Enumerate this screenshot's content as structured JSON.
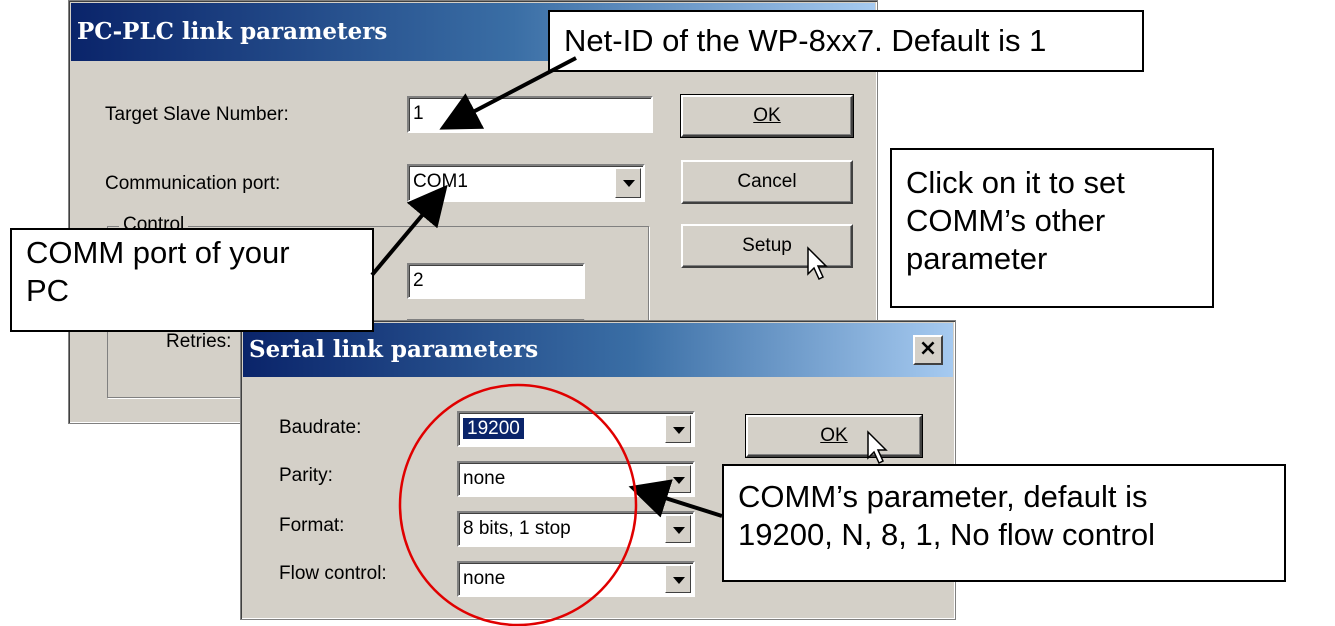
{
  "plc_dialog": {
    "title": "PC-PLC link parameters",
    "target_slave_label": "Target Slave Number:",
    "target_slave_value": "1",
    "comm_port_label": "Communication port:",
    "comm_port_value": "COM1",
    "control_group_label": "Control",
    "timeout_value": "2",
    "retries_label": "Retries:",
    "ok_label": "OK",
    "cancel_label": "Cancel",
    "setup_label": "Setup"
  },
  "serial_dialog": {
    "title": "Serial link parameters",
    "close_glyph": "×",
    "baudrate_label": "Baudrate:",
    "baudrate_value": "19200",
    "parity_label": "Parity:",
    "parity_value": "none",
    "format_label": "Format:",
    "format_value": "8 bits, 1 stop",
    "flow_label": "Flow control:",
    "flow_value": "none",
    "ok_label": "OK"
  },
  "callouts": {
    "net_id": "Net-ID of the WP-8xx7. Default is 1",
    "comm_port_line1": "COMM port of your",
    "comm_port_line2": "PC",
    "setup_line1": "Click on it to set",
    "setup_line2": "COMM’s other",
    "setup_line3": "parameter",
    "comm_param_line1": "COMM’s parameter, default is",
    "comm_param_line2": "19200, N, 8, 1, No flow control"
  },
  "colors": {
    "dialog_face": "#d4d0c8",
    "title_dark": "#0a246a",
    "title_light": "#a6caf0",
    "selection": "#0a246a",
    "highlight_circle": "#e00000"
  },
  "icons": [
    "dropdown-arrow-icon",
    "close-icon",
    "mouse-cursor-icon"
  ]
}
